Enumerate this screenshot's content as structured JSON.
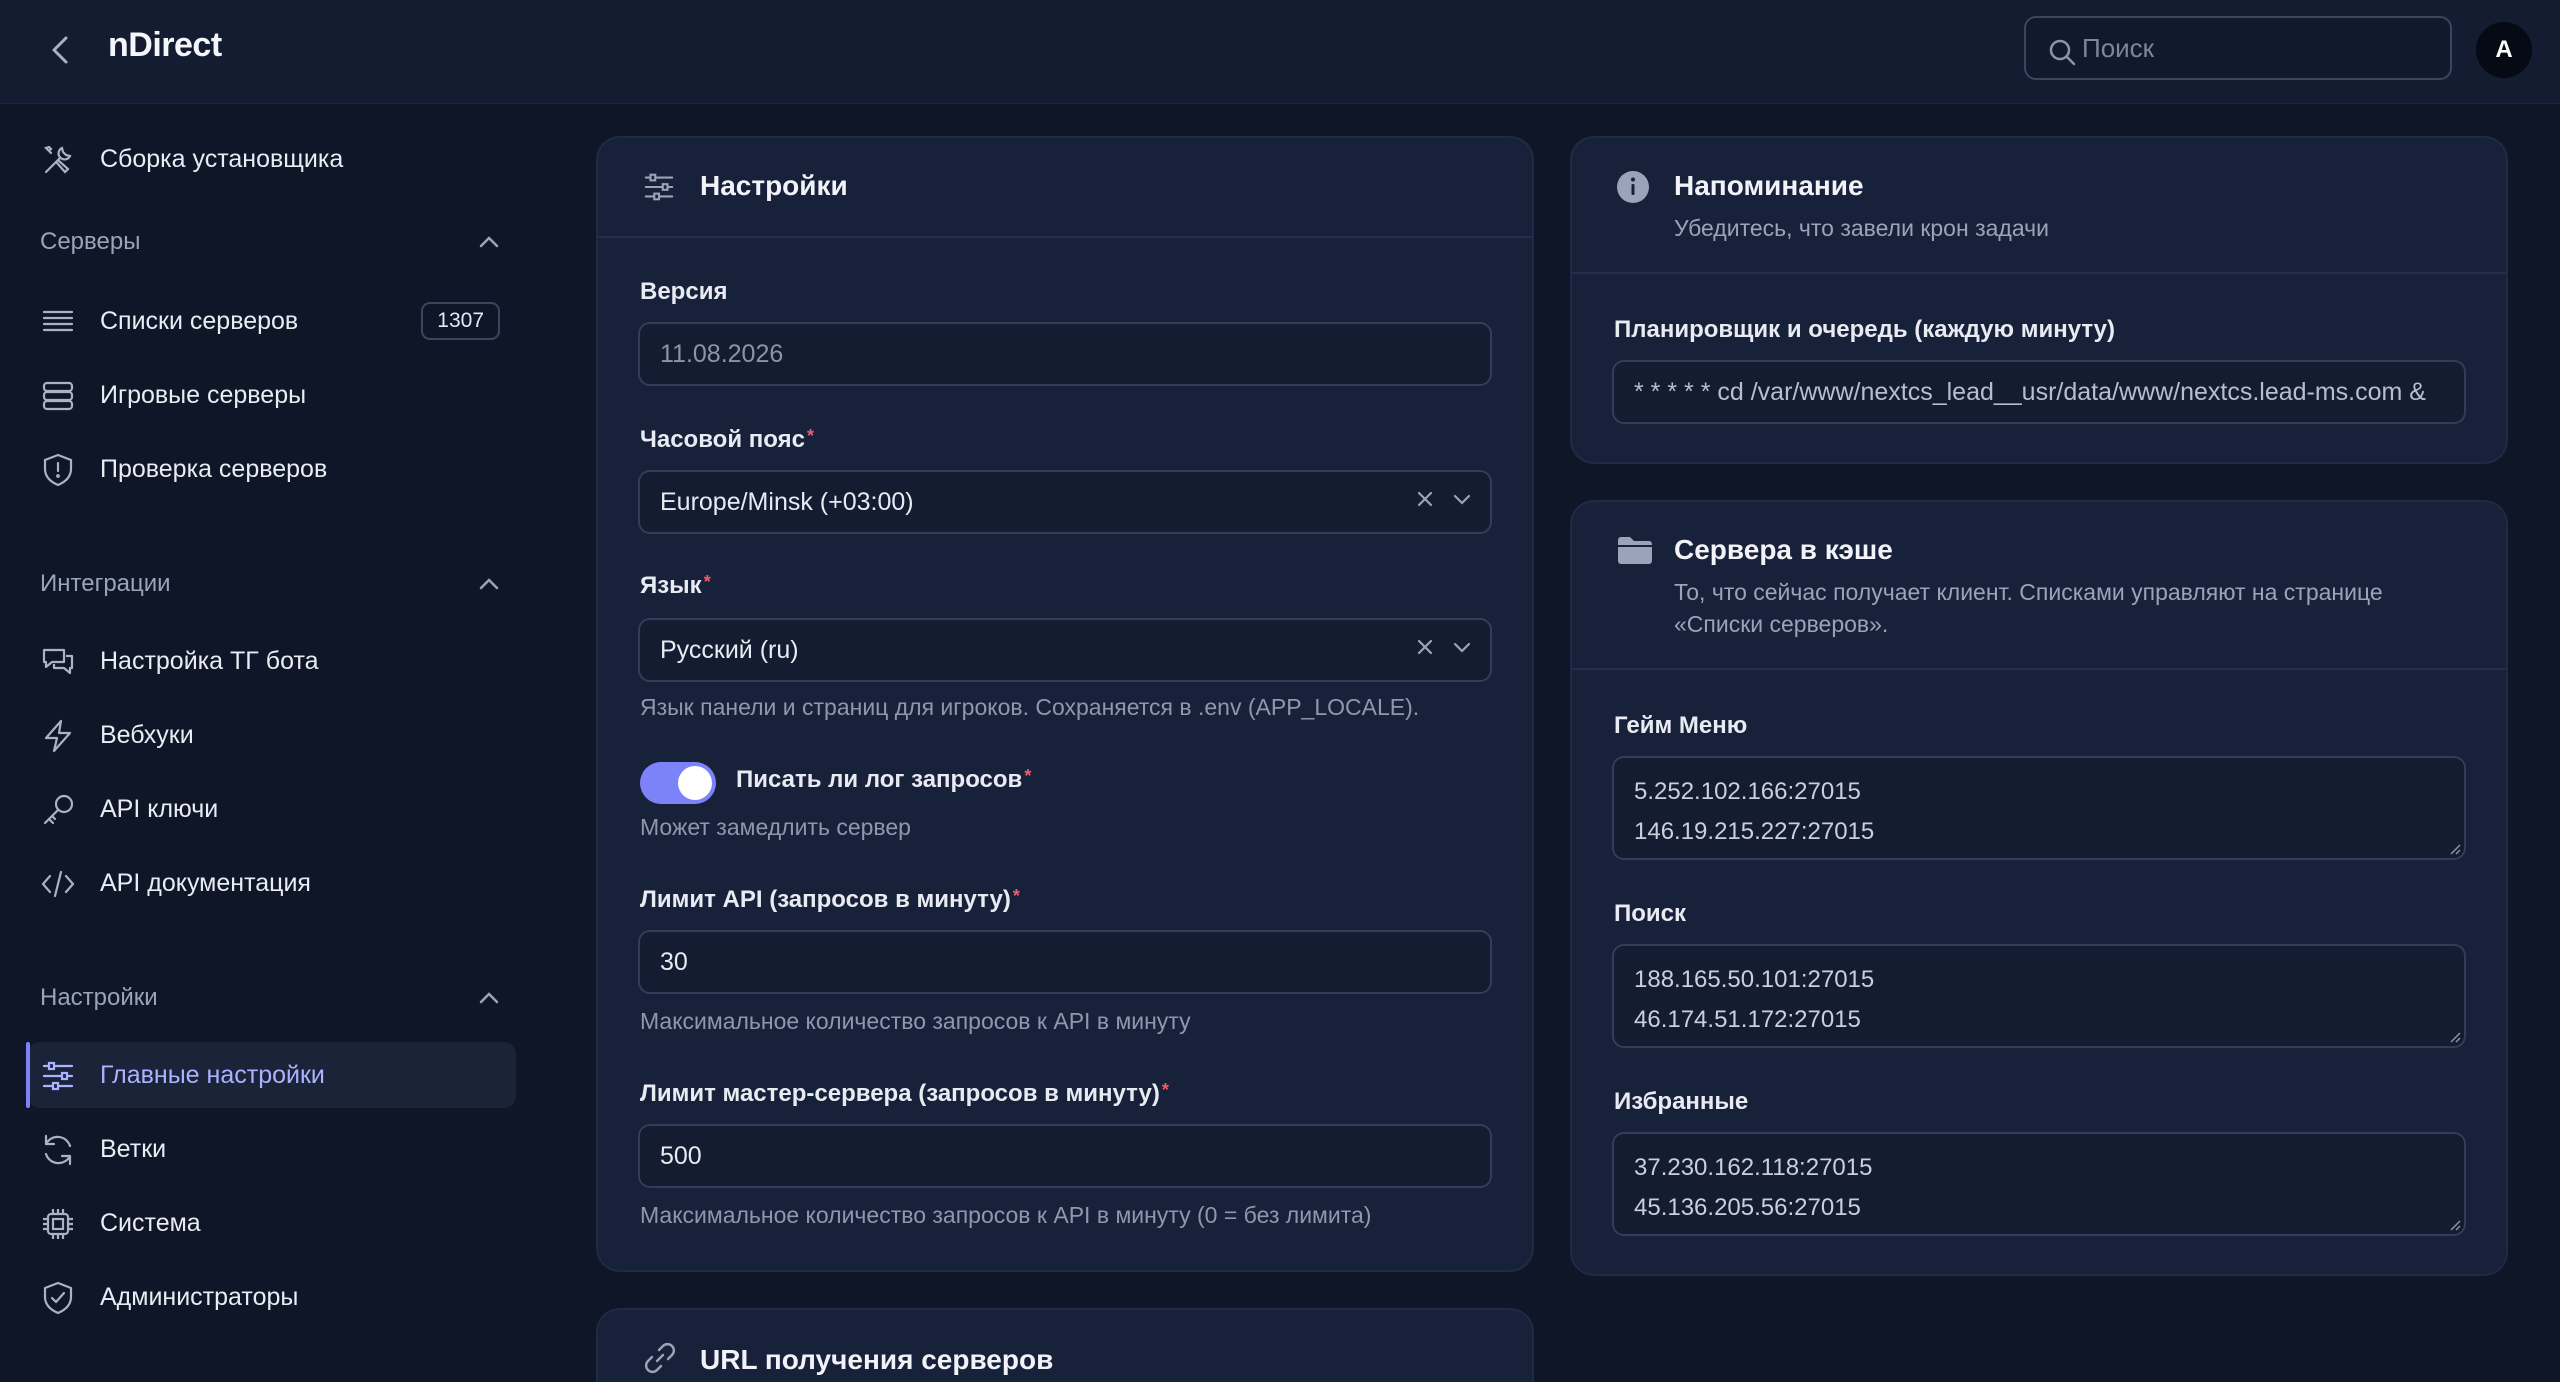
{
  "header": {
    "app_title": "nDirect",
    "search_placeholder": "Поиск",
    "avatar_initial": "A"
  },
  "sidebar": {
    "top_item": {
      "label": "Сборка установщика",
      "icon": "tools-icon"
    },
    "groups": [
      {
        "label": "Серверы",
        "items": [
          {
            "label": "Списки серверов",
            "icon": "list-icon",
            "badge": "1307"
          },
          {
            "label": "Игровые серверы",
            "icon": "server-icon"
          },
          {
            "label": "Проверка серверов",
            "icon": "shield-icon"
          }
        ]
      },
      {
        "label": "Интеграции",
        "items": [
          {
            "label": "Настройка ТГ бота",
            "icon": "chat-icon"
          },
          {
            "label": "Вебхуки",
            "icon": "bolt-icon"
          },
          {
            "label": "API ключи",
            "icon": "key-icon"
          },
          {
            "label": "API документация",
            "icon": "code-icon"
          }
        ]
      },
      {
        "label": "Настройки",
        "items": [
          {
            "label": "Главные настройки",
            "icon": "sliders-icon",
            "active": true
          },
          {
            "label": "Ветки",
            "icon": "refresh-icon"
          },
          {
            "label": "Система",
            "icon": "cpu-icon"
          },
          {
            "label": "Администраторы",
            "icon": "shield-check-icon"
          }
        ]
      }
    ]
  },
  "settings_card": {
    "title": "Настройки",
    "version_label": "Версия",
    "version_value": "11.08.2026",
    "timezone_label": "Часовой пояс",
    "timezone_value": "Europe/Minsk (+03:00)",
    "language_label": "Язык",
    "language_value": "Русский (ru)",
    "language_hint": "Язык панели и страниц для игроков. Сохраняется в .env (APP_LOCALE).",
    "log_toggle_label": "Писать ли лог запросов",
    "log_toggle_on": true,
    "log_toggle_hint": "Может замедлить сервер",
    "api_limit_label": "Лимит API (запросов в минуту)",
    "api_limit_value": "30",
    "api_limit_hint": "Максимальное количество запросов к API в минуту",
    "master_limit_label": "Лимит мастер-сервера (запросов в минуту)",
    "master_limit_value": "500",
    "master_limit_hint": "Максимальное количество запросов к API в минуту (0 = без лимита)"
  },
  "url_card": {
    "title": "URL получения серверов"
  },
  "reminder_card": {
    "title": "Напоминание",
    "subtitle": "Убедитесь, что завели крон задачи",
    "scheduler_label": "Планировщик и очередь (каждую минуту)",
    "scheduler_value": "* * * * * cd /var/www/nextcs_lead__usr/data/www/nextcs.lead-ms.com &"
  },
  "cache_card": {
    "title": "Сервера в кэше",
    "subtitle_line1": "То, что сейчас получает клиент. Списками управляют на странице",
    "subtitle_line2": "«Списки серверов».",
    "game_menu_label": "Гейм Меню",
    "game_menu_lines": [
      "5.252.102.166:27015",
      "146.19.215.227:27015"
    ],
    "search_label": "Поиск",
    "search_lines": [
      "188.165.50.101:27015",
      "46.174.51.172:27015"
    ],
    "favorites_label": "Избранные",
    "favorites_lines": [
      "37.230.162.118:27015",
      "45.136.205.56:27015"
    ]
  },
  "colors": {
    "background": "#0e1628",
    "card": "#18213a",
    "accent": "#7c83f8",
    "required": "#ef5d6c"
  }
}
